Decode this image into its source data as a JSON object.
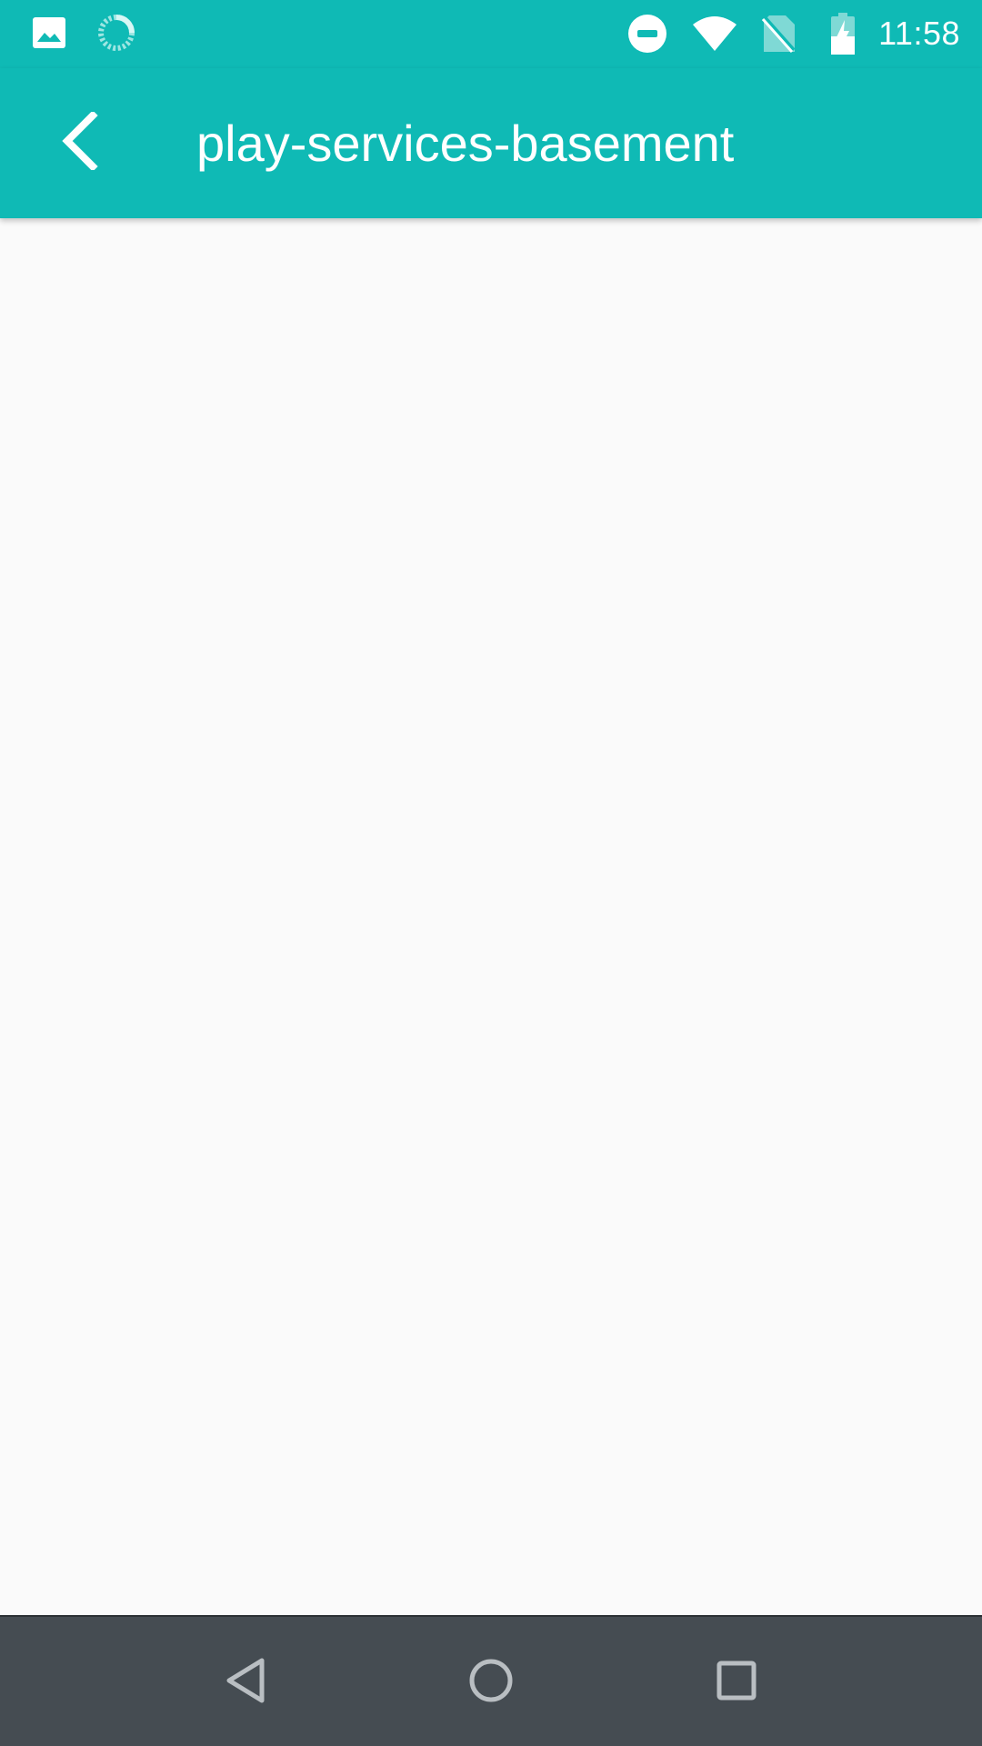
{
  "status_bar": {
    "time": "11:58",
    "icons_left": [
      "image-icon",
      "sync-spinner-icon"
    ],
    "icons_right": [
      "do-not-disturb-icon",
      "wifi-icon",
      "no-sim-icon",
      "battery-charging-icon"
    ]
  },
  "app_bar": {
    "title": "play-services-basement",
    "back_icon": "chevron-left-icon"
  },
  "nav_bar": {
    "buttons": [
      "back-triangle-icon",
      "home-circle-icon",
      "recents-square-icon"
    ]
  },
  "colors": {
    "primary": "#0fbab5",
    "background": "#fafafa",
    "nav_bar": "#454c52",
    "on_primary": "#ffffff"
  }
}
